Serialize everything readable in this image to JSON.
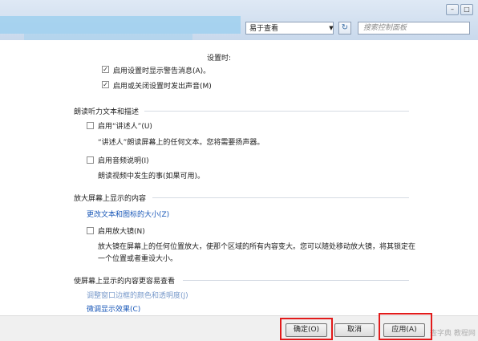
{
  "titlebar": {
    "address_text": "易于查看",
    "search_placeholder": "搜索控制面板"
  },
  "top": {
    "partial_heading": "设置时:",
    "cb_warning_label": "启用设置时显示警告消息(A)。",
    "cb_sound_label": "启用或关闭设置时发出声音(M)",
    "cb_warning_checked": true,
    "cb_sound_checked": true
  },
  "narration": {
    "title": "朗读听力文本和描述",
    "cb_narrator_label": "启用“讲述人”(U)",
    "narrator_desc": "“讲述人”朗读屏幕上的任何文本。您将需要扬声器。",
    "cb_audio_desc_label": "启用音频说明(I)",
    "audio_desc_desc": "朗读视频中发生的事(如果可用)。"
  },
  "magnify": {
    "title": "放大屏幕上显示的内容",
    "link_text_size": "更改文本和图标的大小(Z)",
    "cb_magnifier_label": "启用放大镜(N)",
    "magnifier_desc_1": "放大镜在屏幕上的任何位置放大，使那个区域的所有内容变大。您可以随处移动放大镜，将其锁定在",
    "magnifier_desc_2": "一个位置或者重设大小。"
  },
  "visible": {
    "title": "使屏幕上显示的内容更容易查看",
    "link_window_color": "调整窗口边框的颜色和透明度(J)",
    "link_fine_tune": "微调显示效果(C)"
  },
  "footer": {
    "ok_label": "确定(O)",
    "cancel_label": "取消",
    "apply_label": "应用(A)",
    "watermark": "查字典 教程网"
  },
  "colors": {
    "highlight_box": "#e21b1b",
    "link": "#1a58b8"
  }
}
